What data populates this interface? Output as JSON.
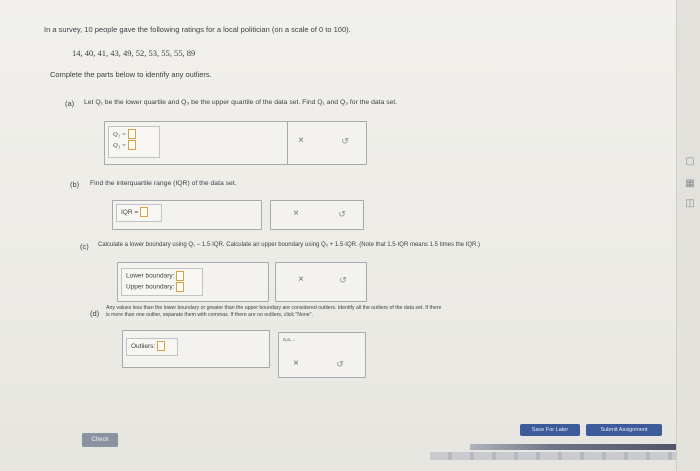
{
  "problem": {
    "intro": "In a survey, 10 people gave the following ratings for a local politician (on a scale of 0 to 100).",
    "data_values": "14, 40, 41, 43, 49, 52, 53, 55, 55, 89",
    "instruction": "Complete the parts below to identify any outliers."
  },
  "part_a": {
    "label": "(a)",
    "prompt": "Let Q₁ be the lower quartile and Q₃ be the upper quartile of the data set. Find Q₁ and Q₃ for the data set.",
    "q1_label": "Q₁ =",
    "q3_label": "Q₃ ="
  },
  "part_b": {
    "label": "(b)",
    "prompt": "Find the interquartile range (IQR) of the data set.",
    "iqr_label": "IQR ="
  },
  "part_c": {
    "label": "(c)",
    "prompt": "Calculate a lower boundary using Q₁ − 1.5·IQR. Calculate an upper boundary using Q₃ + 1.5·IQR. (Note that 1.5·IQR means 1.5 times the IQR.)",
    "lower_label": "Lower boundary:",
    "upper_label": "Upper boundary:"
  },
  "part_d": {
    "label": "(d)",
    "prompt_line1": "Any values less than the lower boundary or greater than the upper boundary are considered outliers. Identify all the outliers of the data set. If there",
    "prompt_line2": "is more than one outlier, separate them with commas. If there are no outliers, click \"None\".",
    "outliers_label": "Outliers:",
    "toolbar_text": "a,a,..."
  },
  "controls": {
    "clear_symbol": "×",
    "undo_symbol": "↺",
    "check_label": "Check",
    "save_label": "Save For Later",
    "submit_label": "Submit Assignment"
  },
  "icons": {
    "clear": "x-icon",
    "undo": "undo-icon",
    "side_tool_1": "calculator-icon",
    "side_tool_2": "grid-icon",
    "side_tool_3": "info-icon"
  },
  "colors": {
    "accent_blue": "#3d5a9a",
    "answer_box_border": "#d9a24a",
    "check_button": "#8b93a1"
  }
}
